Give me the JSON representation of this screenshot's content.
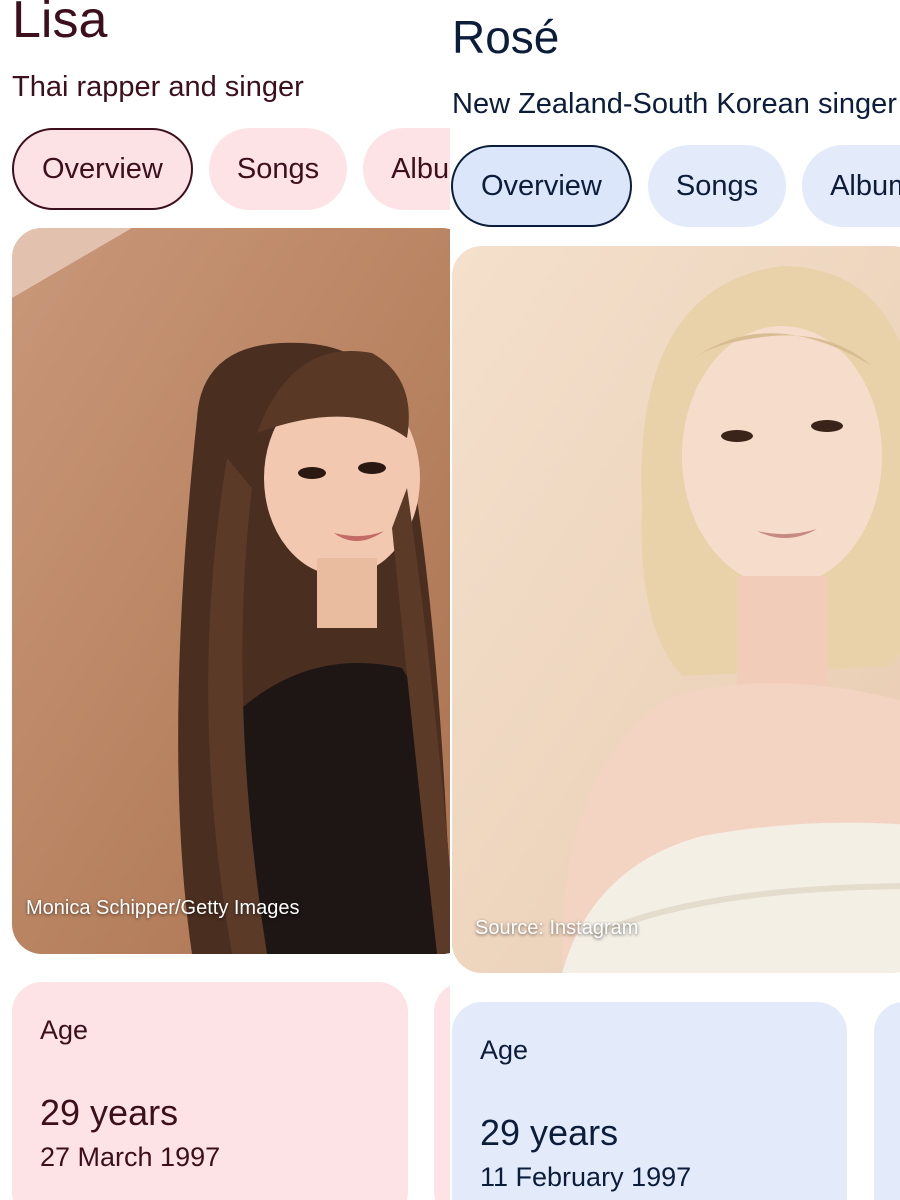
{
  "panels": [
    {
      "title": "Lisa",
      "subtitle": "Thai rapper and singer",
      "tabs": [
        "Overview",
        "Songs",
        "Albums"
      ],
      "image_credit": "Monica Schipper/Getty Images",
      "age_card": {
        "label": "Age",
        "value": "29 years",
        "detail": "27 March 1997"
      },
      "accent": "#3d0f1c",
      "chip_color": "#fde3e6"
    },
    {
      "title": "Rosé",
      "subtitle": "New Zealand-South Korean singer",
      "tabs": [
        "Overview",
        "Songs",
        "Albums"
      ],
      "image_credit": "Source: Instagram",
      "age_card": {
        "label": "Age",
        "value": "29 years",
        "detail": "11 February 1997"
      },
      "accent": "#0b1d3a",
      "chip_color": "#e3ebfb"
    }
  ]
}
